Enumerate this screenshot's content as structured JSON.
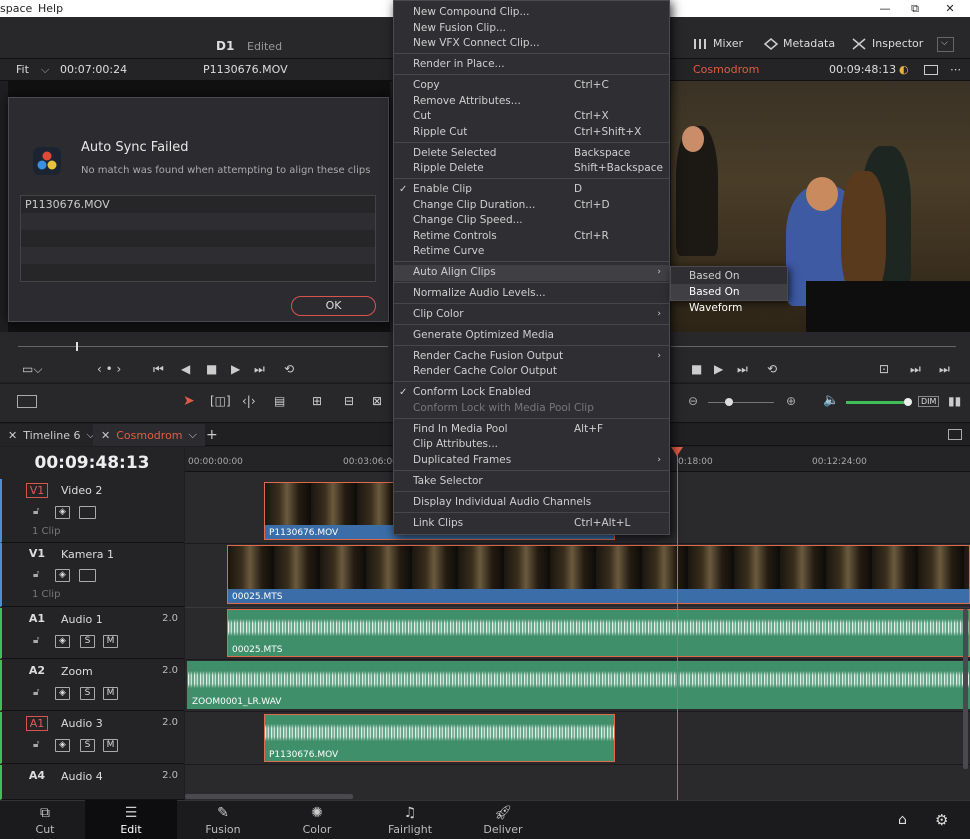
{
  "titlebar": {
    "menu_partial": "space",
    "help": "Help",
    "minimize": "—",
    "maximize": "⧉",
    "close": "✕"
  },
  "header": {
    "project": "D1",
    "status": "Edited",
    "mixer": "Mixer",
    "metadata": "Metadata",
    "inspector": "Inspector"
  },
  "viewer_bar": {
    "fit": "Fit",
    "timecode_left": "00:07:00:24",
    "clip_left": "P1130676.MOV",
    "timeline_name": "Cosmodrom",
    "timecode_right": "00:09:48:13"
  },
  "dialog": {
    "title": "Auto Sync Failed",
    "message": "No match was found when attempting to align these clips",
    "list": [
      "P1130676.MOV",
      "",
      "",
      "",
      ""
    ],
    "ok": "OK"
  },
  "context_menu": {
    "items": [
      {
        "label": "New Compound Clip...",
        "shortcut": ""
      },
      {
        "label": "New Fusion Clip...",
        "shortcut": ""
      },
      {
        "label": "New VFX Connect Clip...",
        "shortcut": ""
      },
      {
        "label": "Render in Place...",
        "shortcut": ""
      },
      {
        "label": "Copy",
        "shortcut": "Ctrl+C"
      },
      {
        "label": "Remove Attributes...",
        "shortcut": ""
      },
      {
        "label": "Cut",
        "shortcut": "Ctrl+X"
      },
      {
        "label": "Ripple Cut",
        "shortcut": "Ctrl+Shift+X"
      },
      {
        "label": "Delete Selected",
        "shortcut": "Backspace"
      },
      {
        "label": "Ripple Delete",
        "shortcut": "Shift+Backspace"
      },
      {
        "label": "Enable Clip",
        "shortcut": "D"
      },
      {
        "label": "Change Clip Duration...",
        "shortcut": "Ctrl+D"
      },
      {
        "label": "Change Clip Speed...",
        "shortcut": ""
      },
      {
        "label": "Retime Controls",
        "shortcut": "Ctrl+R"
      },
      {
        "label": "Retime Curve",
        "shortcut": ""
      },
      {
        "label": "Auto Align Clips",
        "shortcut": ""
      },
      {
        "label": "Normalize Audio Levels...",
        "shortcut": ""
      },
      {
        "label": "Clip Color",
        "shortcut": ""
      },
      {
        "label": "Generate Optimized Media",
        "shortcut": ""
      },
      {
        "label": "Render Cache Fusion Output",
        "shortcut": ""
      },
      {
        "label": "Render Cache Color Output",
        "shortcut": ""
      },
      {
        "label": "Conform Lock Enabled",
        "shortcut": ""
      },
      {
        "label": "Conform Lock with Media Pool Clip",
        "shortcut": ""
      },
      {
        "label": "Find In Media Pool",
        "shortcut": "Alt+F"
      },
      {
        "label": "Clip Attributes...",
        "shortcut": ""
      },
      {
        "label": "Duplicated Frames",
        "shortcut": ""
      },
      {
        "label": "Take Selector",
        "shortcut": ""
      },
      {
        "label": "Display Individual Audio Channels",
        "shortcut": ""
      },
      {
        "label": "Link Clips",
        "shortcut": "Ctrl+Alt+L"
      }
    ],
    "submenu": [
      "Based On Timecode",
      "Based On Waveform"
    ]
  },
  "tabs": {
    "timeline6": "Timeline 6",
    "cosmodrom": "Cosmodrom",
    "add": "+"
  },
  "timeline": {
    "timecode": "00:09:48:13",
    "ruler": [
      "00:00:00:00",
      "00:03:06:00",
      "0:18:00",
      "00:12:24:00"
    ],
    "tracks": {
      "v2": {
        "id": "V1",
        "name": "Video 2",
        "clips": "1 Clip"
      },
      "v1": {
        "id": "V1",
        "name": "Kamera 1",
        "clips": "1 Clip"
      },
      "a1": {
        "id": "A1",
        "name": "Audio 1",
        "ch": "2.0"
      },
      "a2": {
        "id": "A2",
        "name": "Zoom",
        "ch": "2.0"
      },
      "a3": {
        "id": "A1",
        "name": "Audio 3",
        "ch": "2.0"
      },
      "a4": {
        "id": "A4",
        "name": "Audio 4",
        "ch": "2.0"
      }
    },
    "clips": {
      "v2": "P1130676.MOV",
      "v1": "00025.MTS",
      "a1": "00025.MTS",
      "a2": "ZOOM0001_LR.WAV",
      "a3": "P1130676.MOV"
    },
    "ctrl": {
      "s": "S",
      "m": "M"
    }
  },
  "toolbar": {
    "dim": "DIM"
  },
  "pages": {
    "cut": "Cut",
    "edit": "Edit",
    "fusion": "Fusion",
    "color": "Color",
    "fairlight": "Fairlight",
    "deliver": "Deliver"
  },
  "colors": {
    "accent": "#e05b45",
    "video_clip": "#3b6ea8",
    "audio_clip": "#3f8f6a"
  }
}
